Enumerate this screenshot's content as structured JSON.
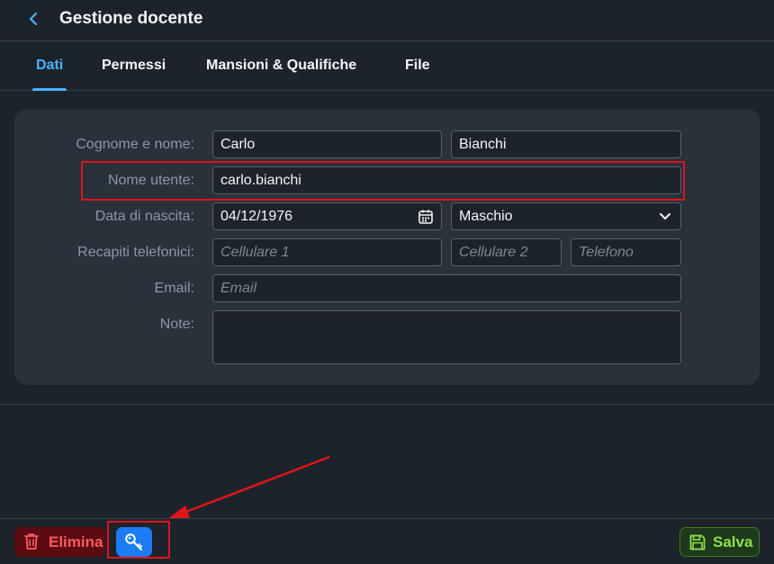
{
  "header": {
    "title": "Gestione docente",
    "back_icon": "chevron-left-icon"
  },
  "tabs": [
    {
      "label": "Dati",
      "active": true
    },
    {
      "label": "Permessi",
      "active": false
    },
    {
      "label": "Mansioni & Qualifiche",
      "active": false
    },
    {
      "label": "File",
      "active": false
    }
  ],
  "form": {
    "name_label": "Cognome e nome:",
    "first_name": "Carlo",
    "last_name": "Bianchi",
    "username_label": "Nome utente:",
    "username": "carlo.bianchi",
    "birth_label": "Data di nascita:",
    "birth_date": "04/12/1976",
    "gender": "Maschio",
    "phones_label": "Recapiti telefonici:",
    "mobile1_placeholder": "Cellulare 1",
    "mobile2_placeholder": "Cellulare 2",
    "phone_placeholder": "Telefono",
    "email_label": "Email:",
    "email_placeholder": "Email",
    "notes_label": "Note:",
    "notes": ""
  },
  "footer": {
    "delete_label": "Elimina",
    "save_label": "Salva",
    "key_icon": "key-icon"
  },
  "colors": {
    "background": "#1d232a",
    "card": "#29313a",
    "accent": "#4db1ff",
    "danger": "#ff5a5f",
    "success": "#8fe04a",
    "annotation": "#e0141b"
  }
}
